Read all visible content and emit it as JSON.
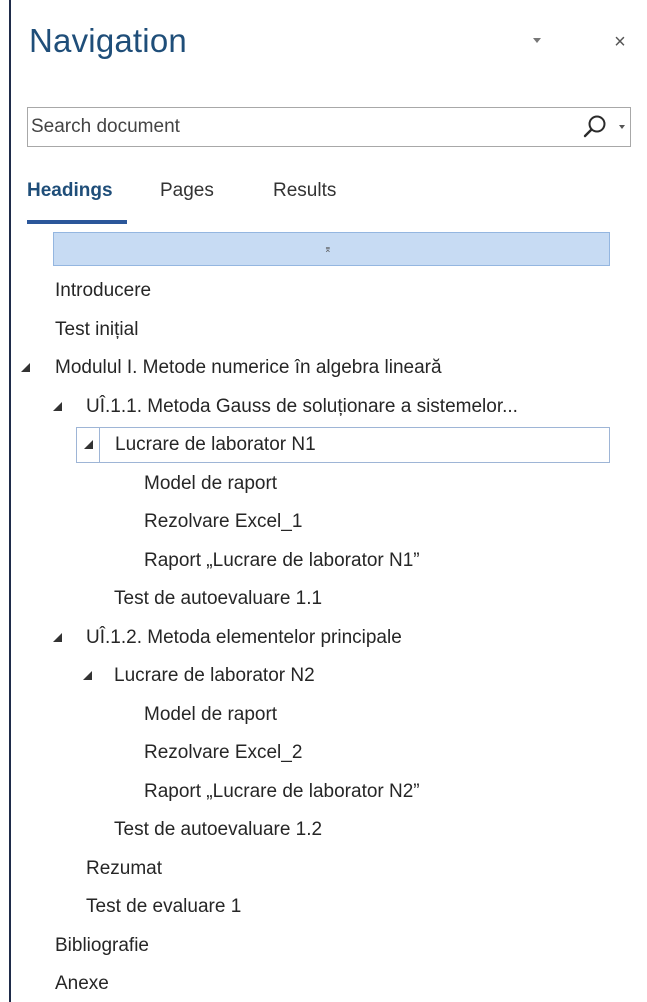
{
  "pane": {
    "title": "Navigation",
    "close_label": "×"
  },
  "search": {
    "placeholder": "Search document",
    "value": ""
  },
  "tabs": [
    {
      "label": "Headings",
      "active": true
    },
    {
      "label": "Pages",
      "active": false
    },
    {
      "label": "Results",
      "active": false
    }
  ],
  "tree": {
    "top_glyph": "⌆",
    "items": [
      {
        "label": "Introducere",
        "level": 0,
        "caret": false
      },
      {
        "label": "Test inițial",
        "level": 0,
        "caret": false
      },
      {
        "label": "Modulul I. Metode numerice în algebra lineară",
        "level": 0,
        "caret": true
      },
      {
        "label": "UÎ.1.1. Metoda Gauss de soluționare a sistemelor...",
        "level": 1,
        "caret": true
      },
      {
        "label": "Lucrare de laborator N1",
        "level": 2,
        "caret": true,
        "selected": true
      },
      {
        "label": "Model de raport",
        "level": 3,
        "caret": false
      },
      {
        "label": "Rezolvare Excel_1",
        "level": 3,
        "caret": false
      },
      {
        "label": "Raport „Lucrare de laborator N1”",
        "level": 3,
        "caret": false
      },
      {
        "label": "Test de autoevaluare 1.1",
        "level": 2,
        "caret": false
      },
      {
        "label": "UÎ.1.2. Metoda elementelor principale",
        "level": 1,
        "caret": true
      },
      {
        "label": "Lucrare de laborator N2",
        "level": 2,
        "caret": true
      },
      {
        "label": "Model de raport",
        "level": 3,
        "caret": false
      },
      {
        "label": "Rezolvare Excel_2",
        "level": 3,
        "caret": false
      },
      {
        "label": "Raport „Lucrare de laborator N2”",
        "level": 3,
        "caret": false
      },
      {
        "label": "Test de autoevaluare 1.2",
        "level": 2,
        "caret": false
      },
      {
        "label": "Rezumat",
        "level": 1,
        "caret": false
      },
      {
        "label": "Test de evaluare 1",
        "level": 1,
        "caret": false
      },
      {
        "label": "Bibliografie",
        "level": 0,
        "caret": false
      },
      {
        "label": "Anexe",
        "level": 0,
        "caret": false
      }
    ]
  },
  "colors": {
    "accent": "#1f4e79",
    "tab_underline": "#2b579a",
    "highlight_bar": "#c7dbf3",
    "selection_border": "#9eb5d6"
  }
}
